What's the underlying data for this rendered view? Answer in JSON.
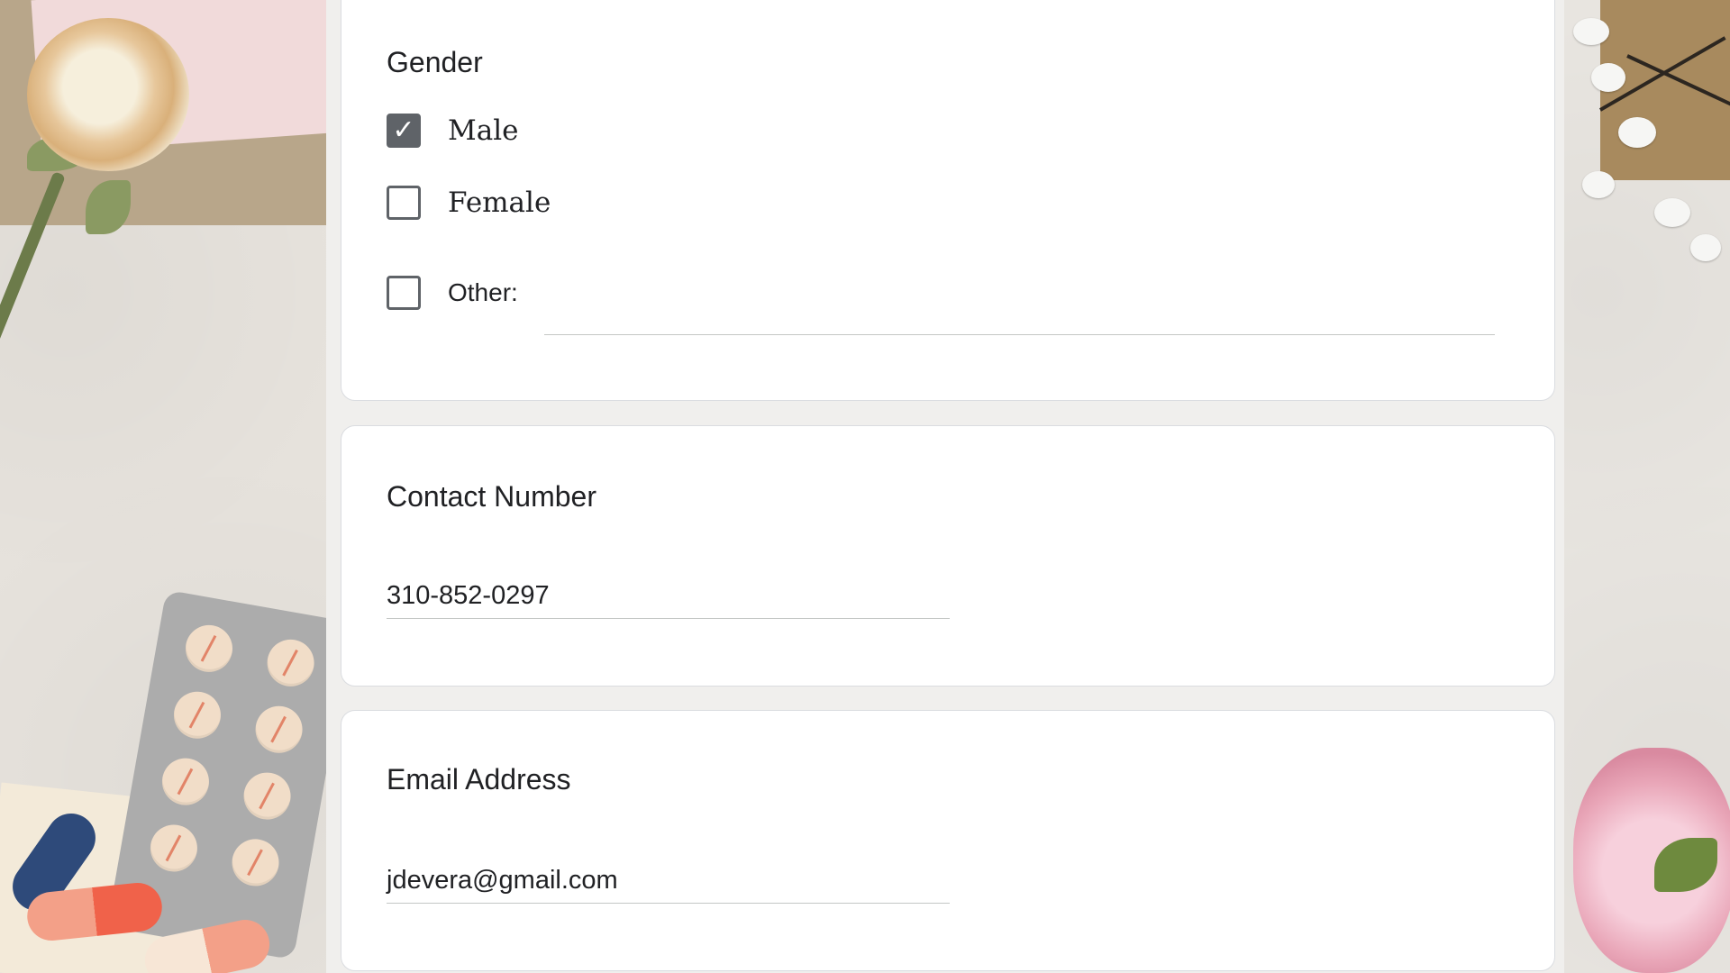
{
  "form": {
    "gender": {
      "title": "Gender",
      "options": [
        {
          "label": "Male",
          "checked": true
        },
        {
          "label": "Female",
          "checked": false
        },
        {
          "label": "Other:",
          "checked": false
        }
      ],
      "other_value": ""
    },
    "contact": {
      "title": "Contact Number",
      "value": "310-852-0297"
    },
    "email": {
      "title": "Email Address",
      "value": "jdevera@gmail.com"
    }
  },
  "icons": {
    "checkmark": "check-icon"
  },
  "colors": {
    "checkbox_checked": "#5f6368",
    "card_border": "#dadce0",
    "page_bg": "#f0efed"
  }
}
